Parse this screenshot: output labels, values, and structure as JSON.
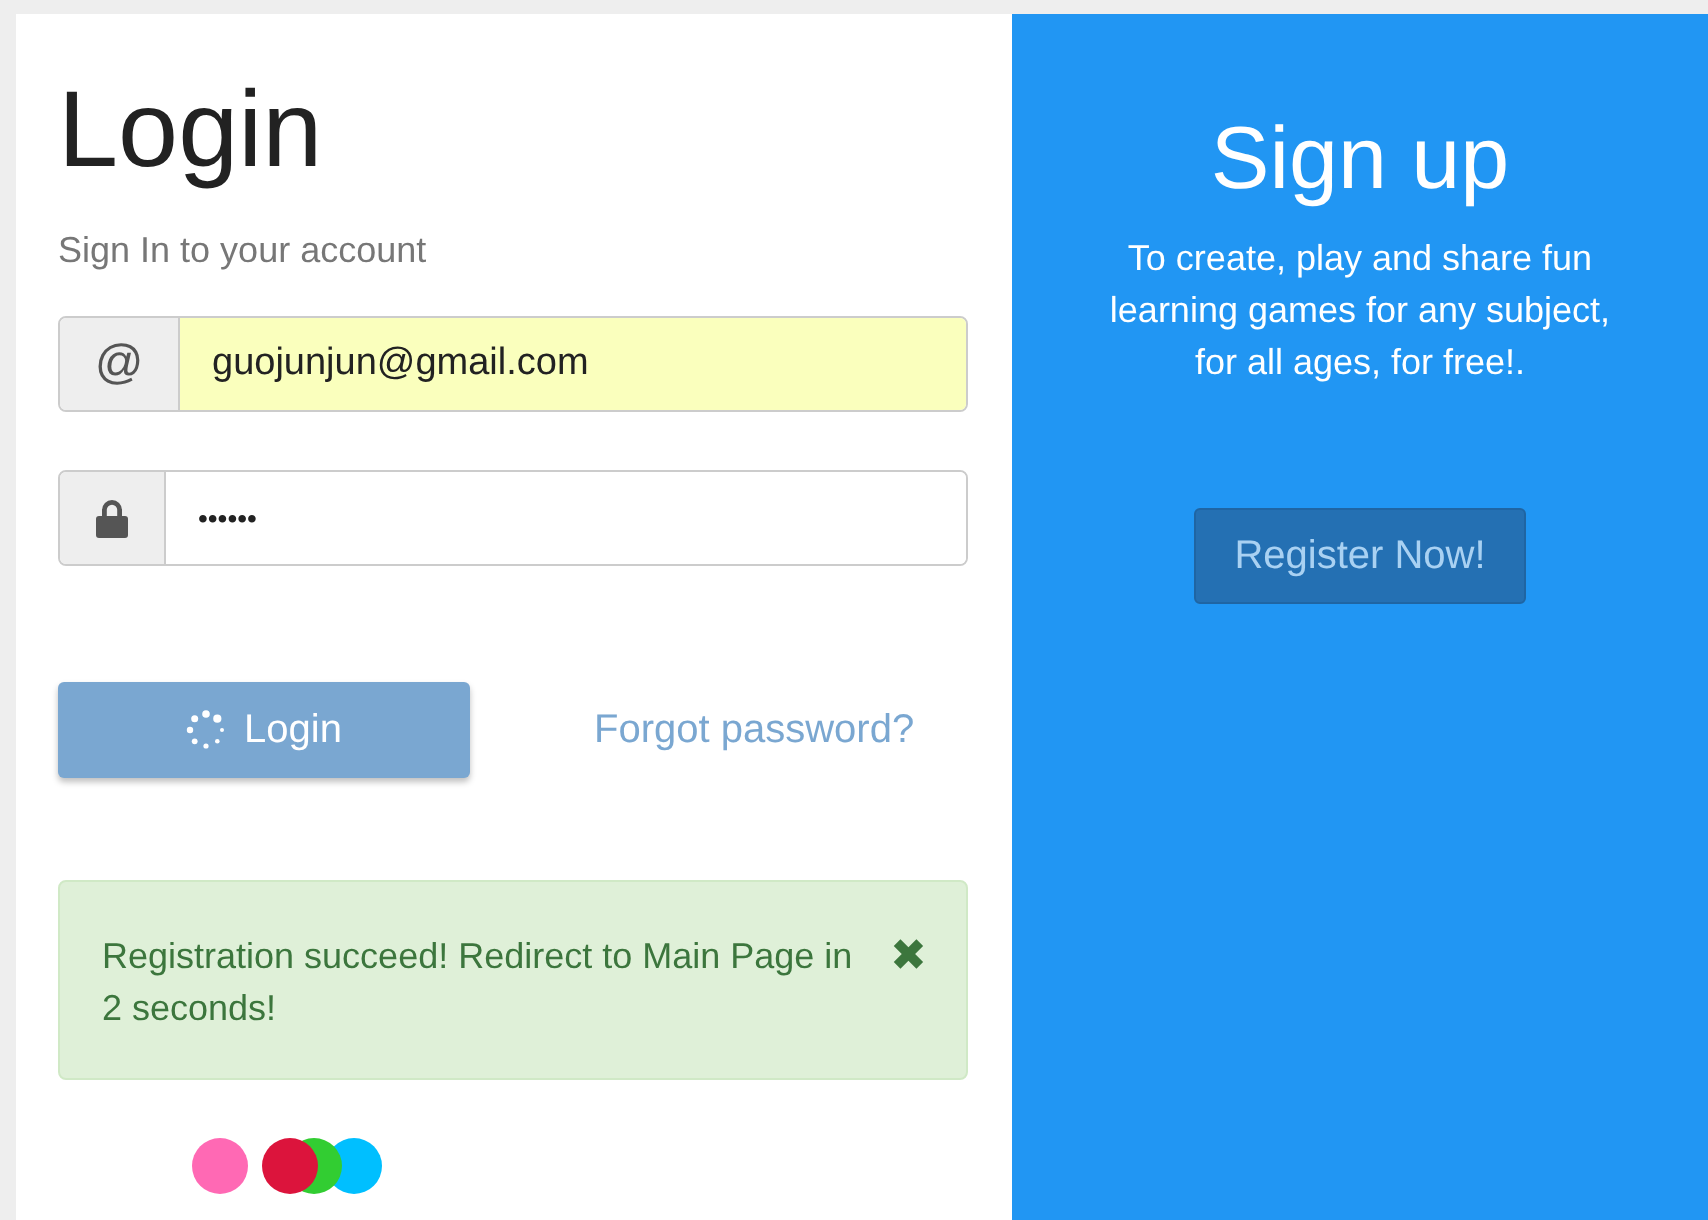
{
  "login": {
    "title": "Login",
    "subtitle": "Sign In to your account",
    "email": {
      "icon": "@",
      "value": "guojunjun@gmail.com",
      "autofilled": true
    },
    "password": {
      "value": "••••••",
      "autofilled": false
    },
    "login_button": {
      "label": "Login",
      "loading": true
    },
    "forgot_link": "Forgot password?",
    "alert": {
      "message": "Registration succeed! Redirect to Main Page in 2 seconds!",
      "close": "✖"
    },
    "loader_dots": [
      {
        "color": "#ff69b4"
      },
      {
        "color": "#dc143c"
      },
      {
        "color": "#32cd32"
      },
      {
        "color": "#00bfff"
      }
    ]
  },
  "signup": {
    "title": "Sign up",
    "text": "To create, play and share fun learning games for any subject, for all ages, for free!.",
    "button": "Register Now!"
  }
}
